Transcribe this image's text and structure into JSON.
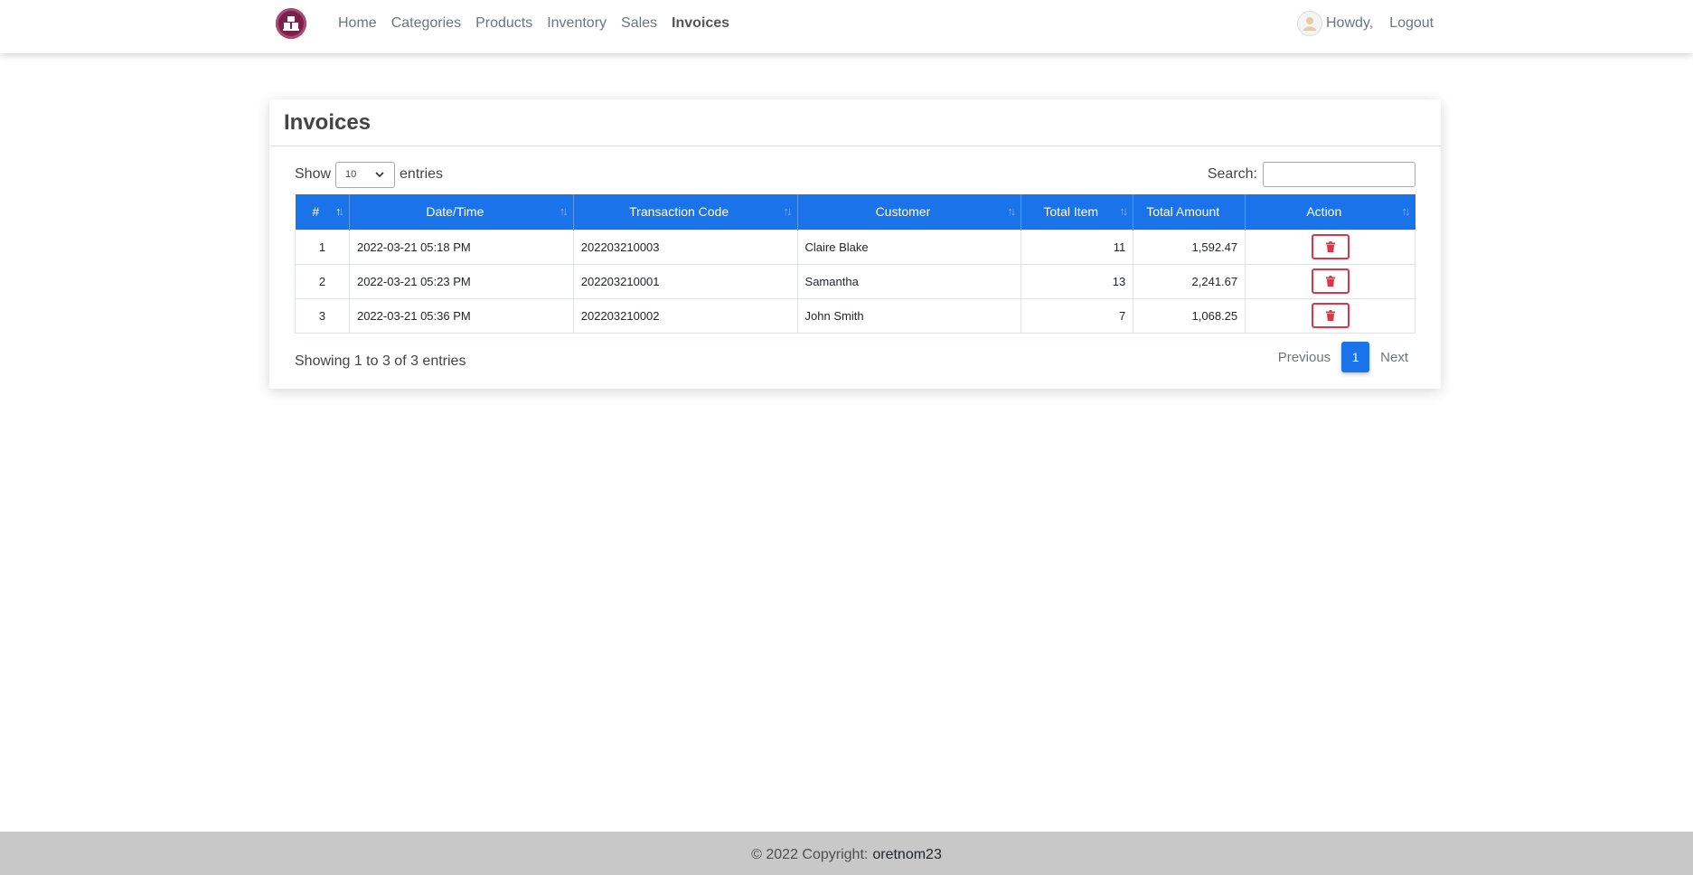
{
  "nav": {
    "brand_icon": "store-logo-icon",
    "links": [
      {
        "label": "Home",
        "active": false
      },
      {
        "label": "Categories",
        "active": false
      },
      {
        "label": "Products",
        "active": false
      },
      {
        "label": "Inventory",
        "active": false
      },
      {
        "label": "Sales",
        "active": false
      },
      {
        "label": "Invoices",
        "active": true
      }
    ],
    "greeting": "Howdy,",
    "logout": "Logout"
  },
  "card": {
    "title": "Invoices"
  },
  "datatable": {
    "show_label": "Show",
    "page_size": "10",
    "entries_label": "entries",
    "search_label": "Search:",
    "search_value": "",
    "columns": [
      "#",
      "Date/Time",
      "Transaction Code",
      "Customer",
      "Total Item",
      "Total Amount",
      "Action"
    ],
    "rows": [
      {
        "num": "1",
        "datetime": "2022-03-21 05:18 PM",
        "code": "202203210003",
        "customer": "Claire Blake",
        "items": "11",
        "amount": "1,592.47"
      },
      {
        "num": "2",
        "datetime": "2022-03-21 05:23 PM",
        "code": "202203210001",
        "customer": "Samantha",
        "items": "13",
        "amount": "2,241.67"
      },
      {
        "num": "3",
        "datetime": "2022-03-21 05:36 PM",
        "code": "202203210002",
        "customer": "John Smith",
        "items": "7",
        "amount": "1,068.25"
      }
    ],
    "info": "Showing 1 to 3 of 3 entries",
    "pagination": {
      "previous": "Previous",
      "current": "1",
      "next": "Next"
    }
  },
  "footer": {
    "copyright": "© 2022 Copyright:",
    "owner": "oretnom23"
  },
  "colors": {
    "primary": "#1a73e8",
    "danger": "#dc3545",
    "brand": "#7a2149",
    "footer_bg": "#c8c8c8"
  }
}
